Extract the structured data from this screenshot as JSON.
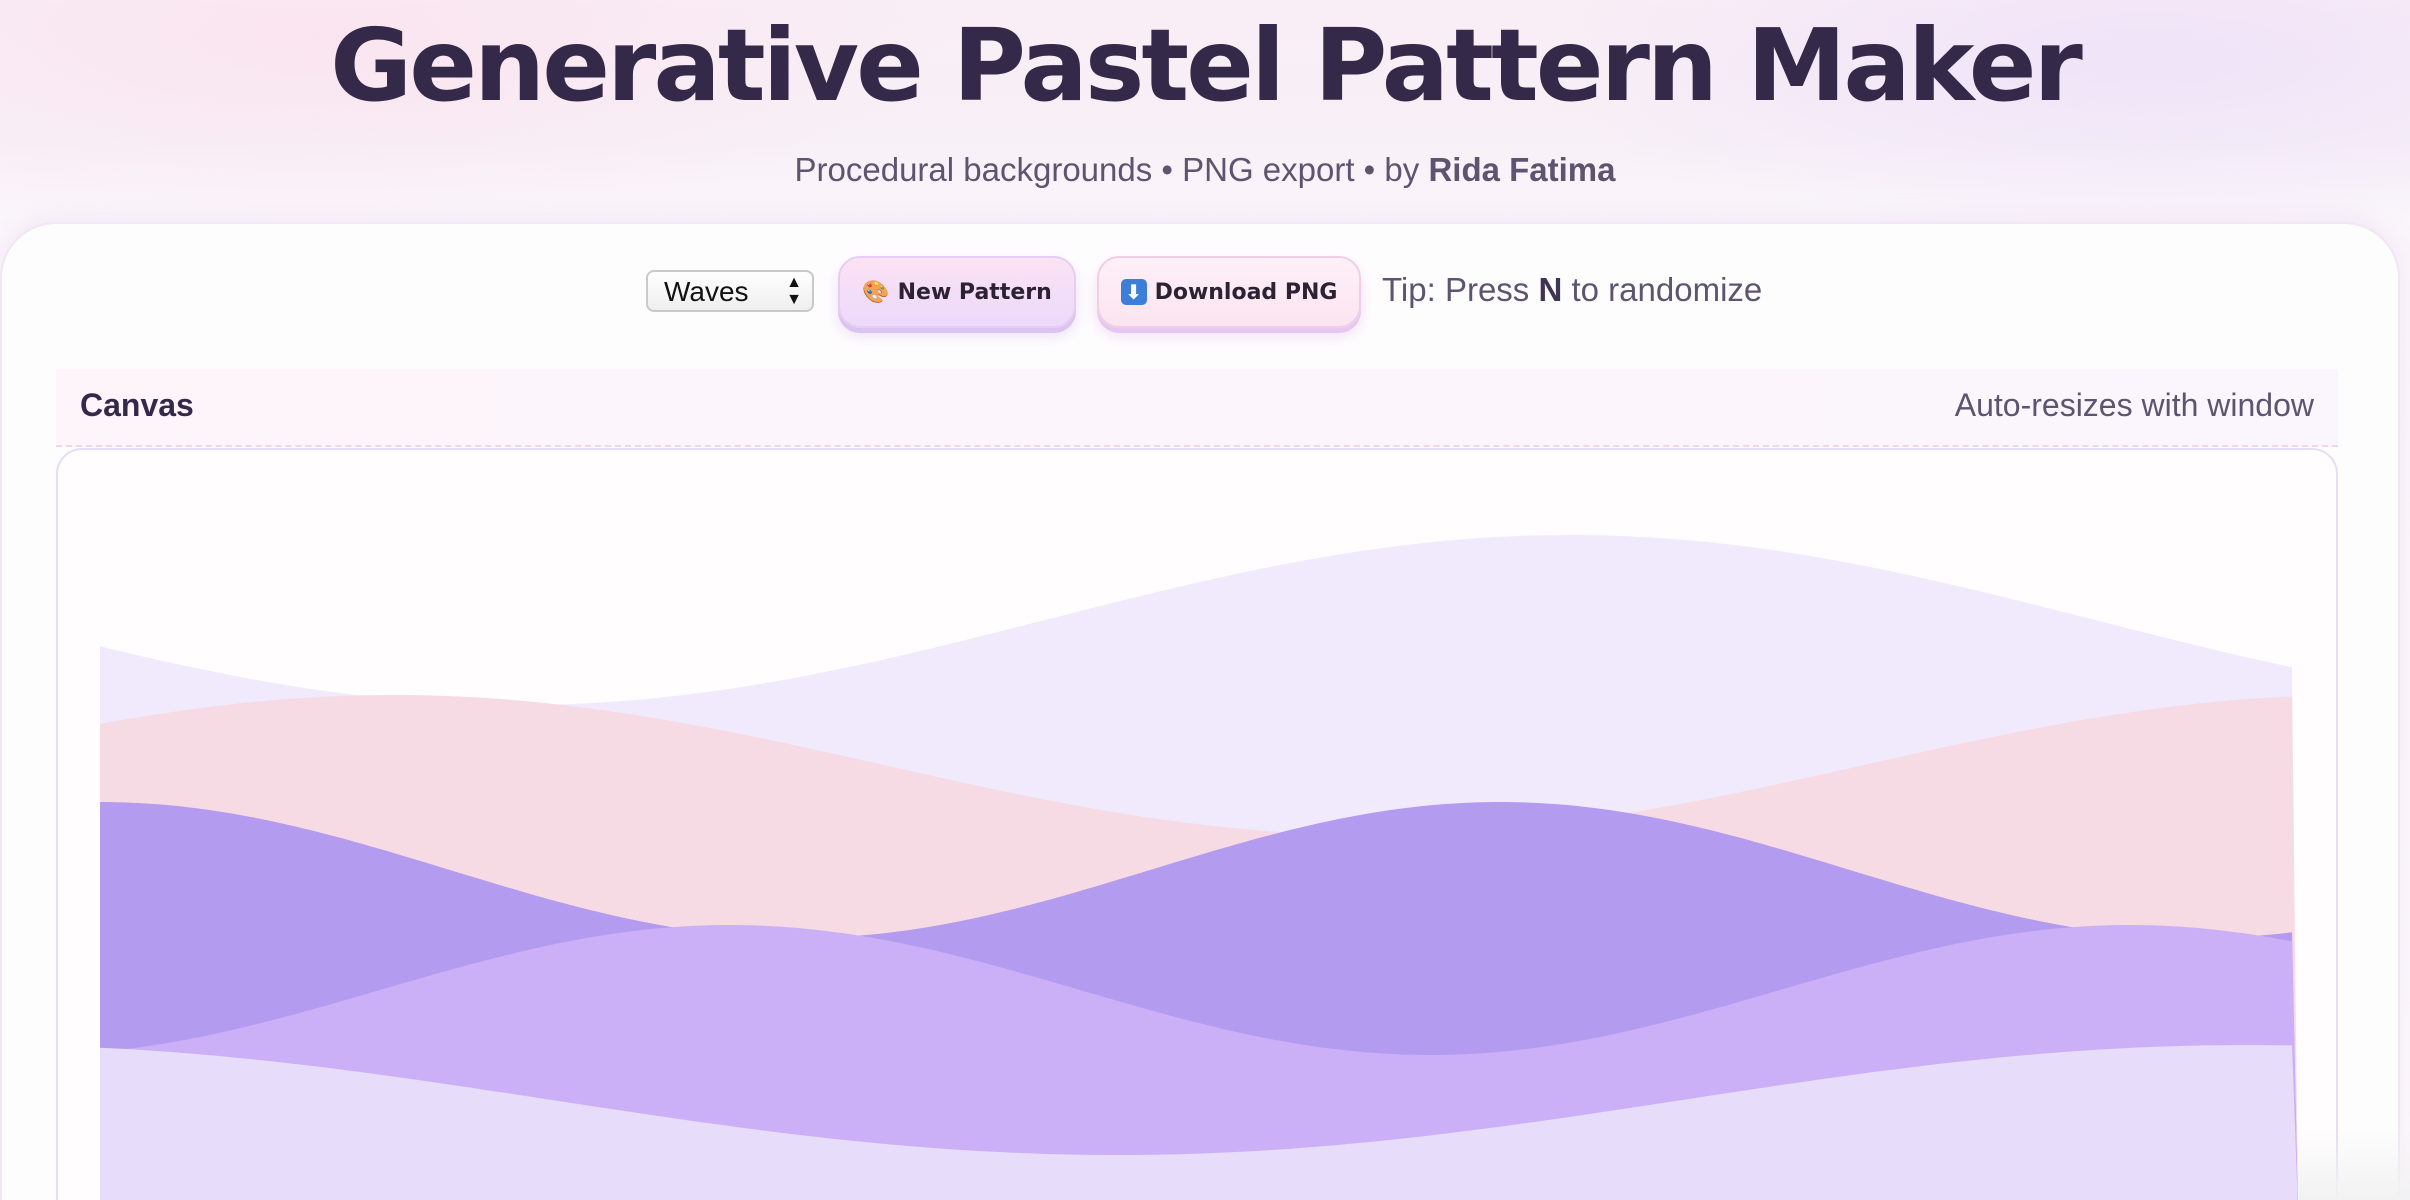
{
  "header": {
    "title": "Generative Pastel Pattern Maker",
    "subtitle_prefix": "Procedural backgrounds • PNG export • by ",
    "author": "Rida Fatima"
  },
  "toolbar": {
    "pattern_select_value": "Waves",
    "new_pattern_icon": "🎨",
    "new_pattern_label": "New Pattern",
    "download_icon": "⬇",
    "download_label": "Download PNG",
    "tip_prefix": "Tip: Press ",
    "tip_key": "N",
    "tip_suffix": " to randomize"
  },
  "canvas": {
    "label": "Canvas",
    "hint": "Auto-resizes with window",
    "wave_colors": [
      "#f1eafc",
      "#f7dbe4",
      "#b39bf0",
      "#cbb0f7",
      "#e8dcfb"
    ]
  }
}
